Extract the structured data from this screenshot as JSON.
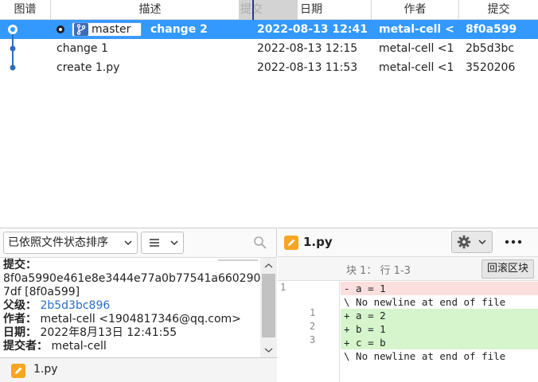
{
  "table": {
    "headers": {
      "graph": "图谱",
      "description": "描述",
      "drag_ghost": "提交",
      "date": "日期",
      "author": "作者",
      "commit": "提交"
    },
    "rows": [
      {
        "description": "change 2",
        "date": "2022-08-13 12:41",
        "author": "metal-cell <1",
        "hash": "8f0a599",
        "branch": "master",
        "selected": true
      },
      {
        "description": "change 1",
        "date": "2022-08-13 12:15",
        "author": "metal-cell <1",
        "hash": "2b5d3bc",
        "selected": false
      },
      {
        "description": "create 1.py",
        "date": "2022-08-13 11:53",
        "author": "metal-cell <1",
        "hash": "3520206",
        "selected": false
      }
    ]
  },
  "bottom_left": {
    "sort_label": "已依照文件状态排序",
    "details": {
      "commit_label": "提交：",
      "commit_hash_line1": "8f0a5990e461e8e3444e77a0b77541a660290",
      "commit_hash_line2": "7df [8f0a599]",
      "parent_label": "父级：",
      "parent_value": "2b5d3bc896",
      "author_label": "作者：",
      "author_value": "metal-cell <1904817346@qq.com>",
      "date_label": "日期：",
      "date_value": "2022年8月13日 12:41:55",
      "committer_label": "提交者：",
      "committer_value": "metal-cell"
    },
    "files": [
      {
        "name": "1.py"
      }
    ]
  },
  "diff": {
    "file_name": "1.py",
    "hunk_label": "块 1： 行 1-3",
    "hunk_button": "回滚区块",
    "lines": [
      {
        "old": "1",
        "new": "",
        "type": "del",
        "text": "- a = 1"
      },
      {
        "old": "",
        "new": "",
        "type": "ctx",
        "text": "\\ No newline at end of file"
      },
      {
        "old": "",
        "new": "1",
        "type": "add",
        "text": "+ a = 2"
      },
      {
        "old": "",
        "new": "2",
        "type": "add",
        "text": "+ b = 1"
      },
      {
        "old": "",
        "new": "3",
        "type": "add",
        "text": "+ c = b"
      },
      {
        "old": "",
        "new": "",
        "type": "ctx",
        "text": "\\ No newline at end of file"
      }
    ]
  },
  "colors": {
    "selection": "#3399ff",
    "graph_line": "#2f6db8",
    "added_bg": "#d6f5cc",
    "removed_bg": "#fbdede",
    "file_icon": "#f5a623"
  },
  "icons": {
    "branch": "branch-icon",
    "search": "search-icon",
    "list_view": "list-icon",
    "gear": "gear-icon",
    "more": "more-dots-icon",
    "file": "pencil-file-icon"
  }
}
